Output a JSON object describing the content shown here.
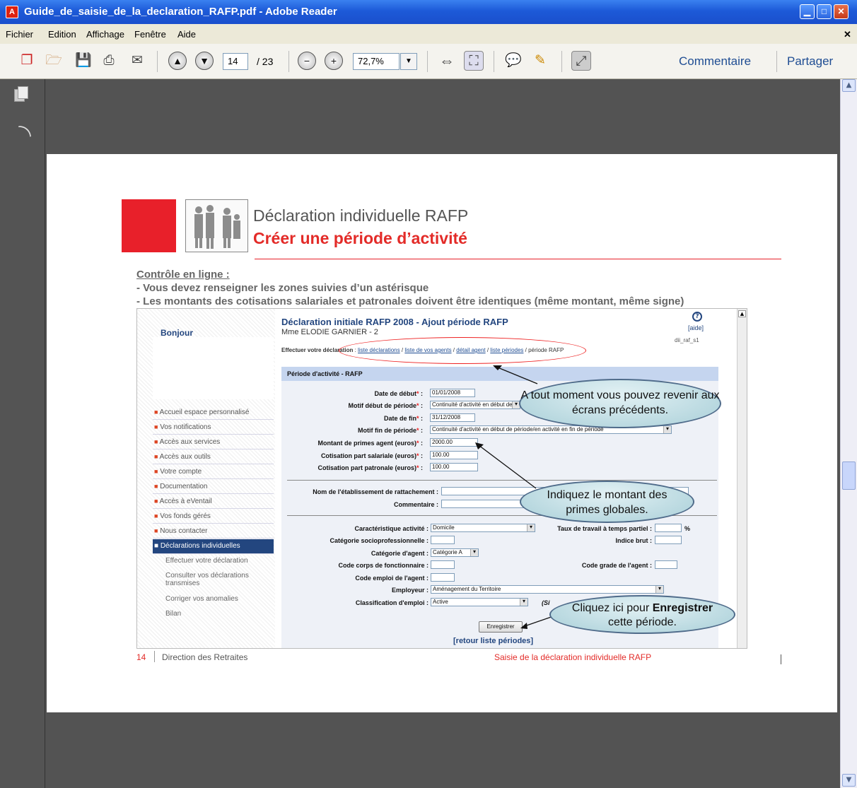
{
  "window": {
    "title": "Guide_de_saisie_de_la_declaration_RAFP.pdf - Adobe Reader"
  },
  "menu": [
    "Fichier",
    "Edition",
    "Affichage",
    "Fenêtre",
    "Aide"
  ],
  "toolbar": {
    "page_current": "14",
    "page_total": "/ 23",
    "zoom": "72,7%",
    "comment_label": "Commentaire",
    "share_label": "Partager"
  },
  "doc": {
    "title_line1": "Déclaration individuelle RAFP",
    "title_line2": "Créer une période d’activité",
    "controle_heading": "Contrôle en ligne :",
    "controle_line1": "- Vous devez renseigner les zones suivies d’un astérisque",
    "controle_line2": "- Les montants des cotisations salariales et patronales doivent être identiques (même montant, même signe)",
    "footer_page": "14",
    "footer_left": "Direction des Retraites",
    "footer_right": "Saisie de la déclaration individuelle RAFP"
  },
  "screenshot": {
    "bonjour": "Bonjour",
    "nav_items": [
      "Accueil espace personnalisé",
      "Vos notifications",
      "Accès aux services",
      "Accès aux outils",
      "Votre compte",
      "Documentation",
      "Accès à eVentail",
      "Vos fonds gérés",
      "Nous contacter",
      "Déclarations individuelles"
    ],
    "sub_items": [
      "Effectuer votre déclaration",
      "Consulter vos déclarations transmises",
      "Corriger vos anomalies",
      "Bilan"
    ],
    "heading": "Déclaration initiale RAFP 2008 - Ajout période RAFP",
    "person": "Mme ELODIE GARNIER - 2",
    "aide": "[aide]",
    "code": "dii_raf_s1",
    "breadcrumb_lead": "Effectuer votre déclaration",
    "breadcrumb_links": [
      "liste déclarations",
      "liste de vos agents",
      "détail agent",
      "liste périodes"
    ],
    "breadcrumb_tail": "période RAFP",
    "section_title": "Période d'activité - RAFP",
    "labels": {
      "date_debut": "Date de début",
      "motif_debut": "Motif début de période",
      "date_fin": "Date de fin",
      "motif_fin": "Motif fin de période",
      "montant_primes": "Montant de primes agent (euros)",
      "cot_salariale": "Cotisation part salariale (euros)",
      "cot_patronale": "Cotisation part patronale (euros)",
      "nom_etab": "Nom de l'établissement de rattachement :",
      "commentaire": "Commentaire :",
      "caract_activite": "Caractéristique activité :",
      "taux_travail": "Taux de travail à temps partiel :",
      "cat_socio": "Catégorie socioprofessionnelle :",
      "indice_brut": "Indice brut :",
      "cat_agent": "Catégorie d'agent :",
      "code_corps": "Code corps de fonctionnaire :",
      "code_grade": "Code grade de l'agent :",
      "code_emploi": "Code emploi de l'agent :",
      "employeur": "Employeur :",
      "classification": "Classification d'emploi :"
    },
    "values": {
      "date_debut": "01/01/2008",
      "motif_debut": "Continuité d'activité en début de période",
      "date_fin": "31/12/2008",
      "motif_fin": "Continuité d'activité en début de période/en activité en fin de période",
      "montant_primes": "2000.00",
      "cot_salariale": "100.00",
      "cot_patronale": "100.00",
      "caract_activite": "Domicile",
      "cat_agent": "Catégorie A",
      "employeur": "Aménagement du Territoire",
      "classification": "Active"
    },
    "percent": "%",
    "si_label": "(Si",
    "save_button": "Enregistrer",
    "retour_link": "[retour liste périodes]"
  },
  "callouts": {
    "c1": "A tout moment vous pouvez revenir aux écrans précédents.",
    "c2": "Indiquez le montant des primes globales.",
    "c3_pre": "Cliquez ici pour",
    "c3_bold": "Enregistrer",
    "c3_post": "cette période."
  },
  "colors": {
    "accent_red": "#e8202a",
    "link_blue": "#1f4d93",
    "nav_selected": "#23467f"
  }
}
